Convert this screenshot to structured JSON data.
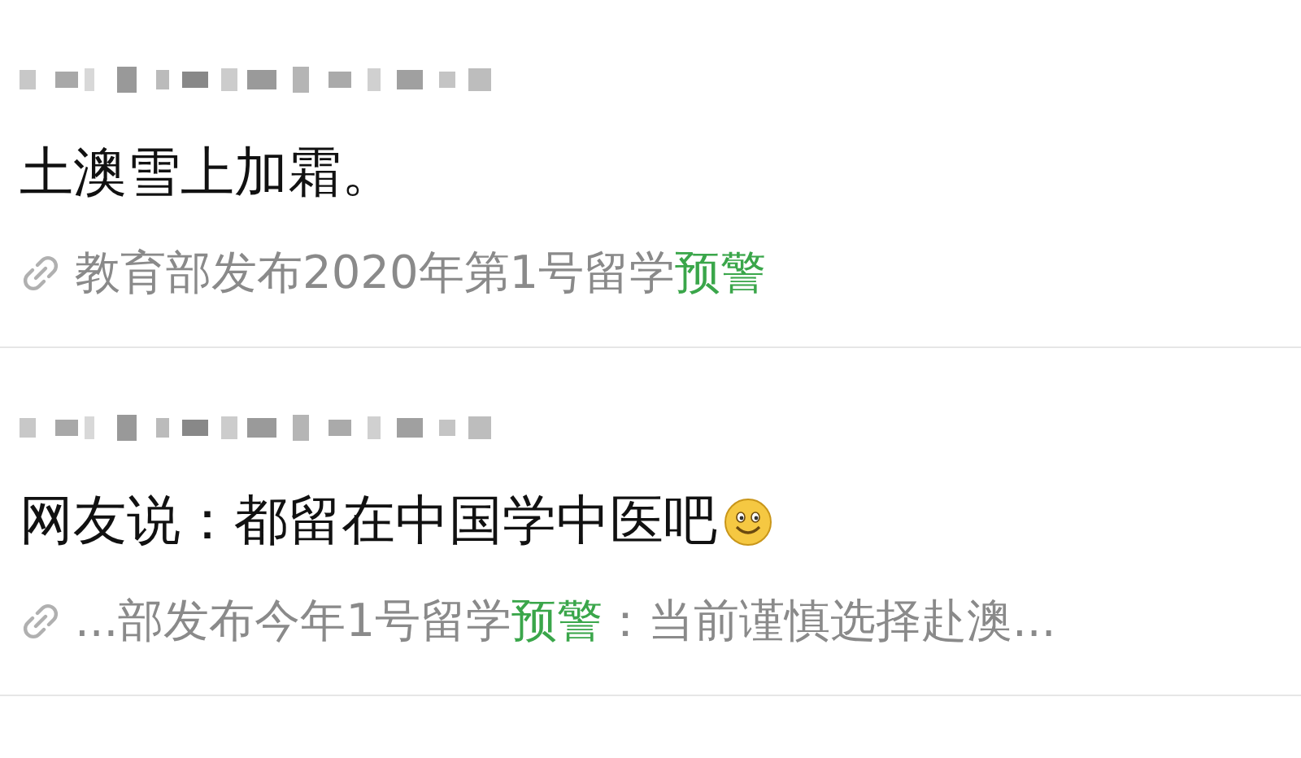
{
  "posts": [
    {
      "name_blurred": true,
      "text": "土澳雪上加霜。",
      "has_emoji": false,
      "link": [
        {
          "text": "教育部发布2020年第1号留学",
          "highlight": false
        },
        {
          "text": "预警",
          "highlight": true
        }
      ]
    },
    {
      "name_blurred": true,
      "text": "网友说：都留在中国学中医吧",
      "has_emoji": true,
      "link": [
        {
          "text": "...部发布今年1号留学",
          "highlight": false
        },
        {
          "text": "预警",
          "highlight": true
        },
        {
          "text": "：当前谨慎选择赴澳...",
          "highlight": false
        }
      ]
    }
  ]
}
